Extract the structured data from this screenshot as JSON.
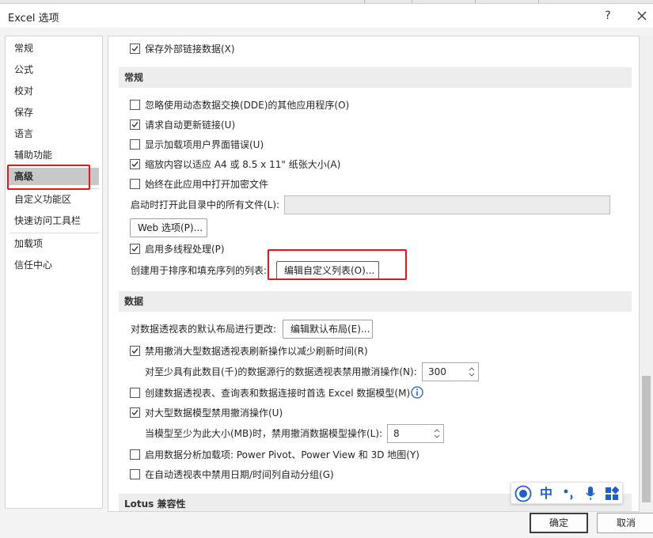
{
  "window": {
    "title": "Excel 选项",
    "help": "?"
  },
  "sidebar": {
    "items": [
      "常规",
      "公式",
      "校对",
      "保存",
      "语言",
      "辅助功能",
      "高级",
      "自定义功能区",
      "快速访问工具栏",
      "加载项",
      "信任中心"
    ],
    "active": "高级"
  },
  "content": {
    "top_option": {
      "label": "保存外部链接数据(X)",
      "checked": true
    },
    "general": {
      "header": "常规",
      "options": [
        {
          "label": "忽略使用动态数据交换(DDE)的其他应用程序(O)",
          "checked": false
        },
        {
          "label": "请求自动更新链接(U)",
          "checked": true
        },
        {
          "label": "显示加载项用户界面错误(U)",
          "checked": false
        },
        {
          "label": "缩放内容以适应 A4 或 8.5 x 11\" 纸张大小(A)",
          "checked": true
        },
        {
          "label": "始终在此应用中打开加密文件",
          "checked": false
        }
      ],
      "startup_label": "启动时打开此目录中的所有文件(L):",
      "startup_value": "",
      "web_options_button": "Web 选项(P)...",
      "multithread": {
        "label": "启用多线程处理(P)",
        "checked": true
      },
      "custom_list_label": "创建用于排序和填充序列的列表:",
      "custom_list_button": "编辑自定义列表(O)..."
    },
    "data": {
      "header": "数据",
      "default_layout_label": "对数据透视表的默认布局进行更改:",
      "default_layout_button": "编辑默认布局(E)...",
      "disable_undo_refresh": {
        "label": "禁用撤消大型数据透视表刷新操作以减少刷新时间(R)",
        "checked": true
      },
      "undo_rows_label": "对至少具有此数目(千)的数据源行的数据透视表禁用撤消操作(N):",
      "undo_rows_value": "300",
      "prefer_data_model": {
        "label": "创建数据透视表、查询表和数据连接时首选 Excel 数据模型(M)",
        "checked": false
      },
      "disable_undo_model": {
        "label": "对大型数据模型禁用撤消操作(U)",
        "checked": true
      },
      "model_size_label": "当模型至少为此大小(MB)时，禁用撤消数据模型操作(L):",
      "model_size_value": "8",
      "analysis_addins": {
        "label": "启用数据分析加载项: Power Pivot、Power View 和 3D 地图(Y)",
        "checked": false
      },
      "disable_date_group": {
        "label": "在自动透视表中禁用日期/时间列自动分组(G)",
        "checked": false
      }
    },
    "lotus": {
      "header": "Lotus 兼容性"
    }
  },
  "ime": {
    "zh": "中"
  },
  "footer": {
    "ok": "确定",
    "cancel": "取消"
  },
  "colors": {
    "highlight": "#e8141a",
    "info": "#1e5fd0"
  }
}
